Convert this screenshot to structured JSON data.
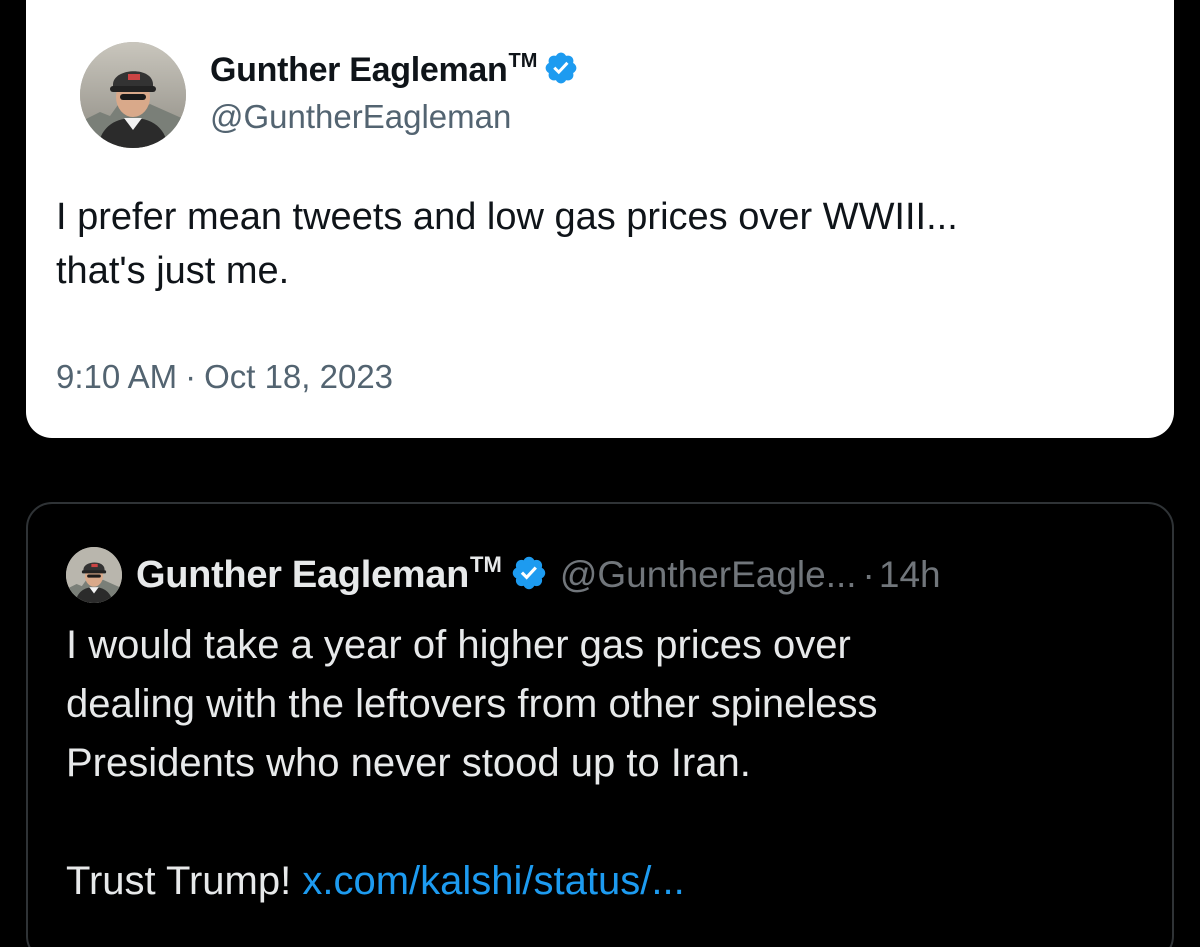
{
  "colors": {
    "background": "#000000",
    "light_card": "#ffffff",
    "verified_blue": "#1d9bf0",
    "link_blue": "#1d9bf0",
    "muted_light": "#536471",
    "muted_dark": "#71767b"
  },
  "tweet": {
    "display_name": "Gunther Eagleman",
    "trademark": "TM",
    "verified_icon": "verified-badge-icon",
    "handle": "@GuntherEagleman",
    "text_line1": "I prefer mean tweets and low gas prices over WWIII...",
    "text_line2": "that's just me.",
    "time": "9:10 AM",
    "separator": "·",
    "date": "Oct 18, 2023"
  },
  "quoted_tweet": {
    "display_name": "Gunther Eagleman",
    "trademark": "TM",
    "verified_icon": "verified-badge-icon",
    "handle": "@GuntherEagle...",
    "separator": "·",
    "age": "14h",
    "text_line1": "I would take a year of higher gas prices over",
    "text_line2": "dealing with the leftovers from other spineless",
    "text_line3": "Presidents who never stood up to Iran.",
    "text_line4": "Trust Trump!",
    "link_text": "x.com/kalshi/status/..."
  }
}
